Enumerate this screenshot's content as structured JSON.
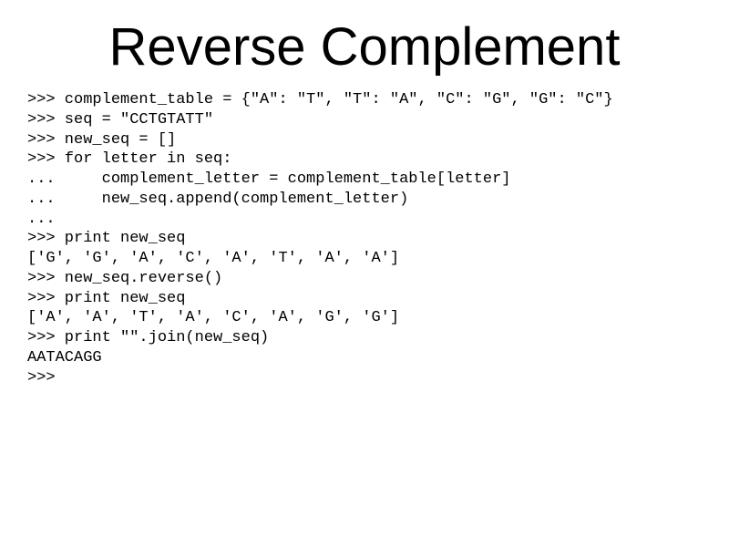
{
  "title": "Reverse Complement",
  "code_lines": [
    ">>> complement_table = {\"A\": \"T\", \"T\": \"A\", \"C\": \"G\", \"G\": \"C\"}",
    ">>> seq = \"CCTGTATT\"",
    ">>> new_seq = []",
    ">>> for letter in seq:",
    "...     complement_letter = complement_table[letter]",
    "...     new_seq.append(complement_letter)",
    "...",
    ">>> print new_seq",
    "['G', 'G', 'A', 'C', 'A', 'T', 'A', 'A']",
    ">>> new_seq.reverse()",
    ">>> print new_seq",
    "['A', 'A', 'T', 'A', 'C', 'A', 'G', 'G']",
    ">>> print \"\".join(new_seq)",
    "AATACAGG",
    ">>>"
  ]
}
